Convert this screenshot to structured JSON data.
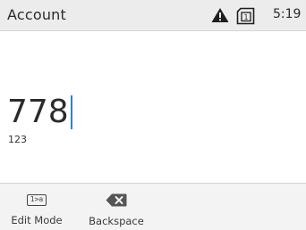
{
  "status_bar": {
    "title": "Account",
    "time": "5:19",
    "sim_slot": "1",
    "icons": [
      "warning-icon",
      "sim-card-icon"
    ]
  },
  "entry": {
    "value": "778",
    "input_mode": "123"
  },
  "softkeys": {
    "edit_mode": {
      "label": "Edit Mode",
      "icon_text": "1>a",
      "icon": "edit-mode-icon"
    },
    "backspace": {
      "label": "Backspace",
      "icon": "backspace-icon"
    }
  },
  "colors": {
    "status_bar_bg": "#ececec",
    "softkey_bar_bg": "#f3f3f3",
    "caret": "#2f7fd6",
    "text": "#2b2b2b"
  }
}
